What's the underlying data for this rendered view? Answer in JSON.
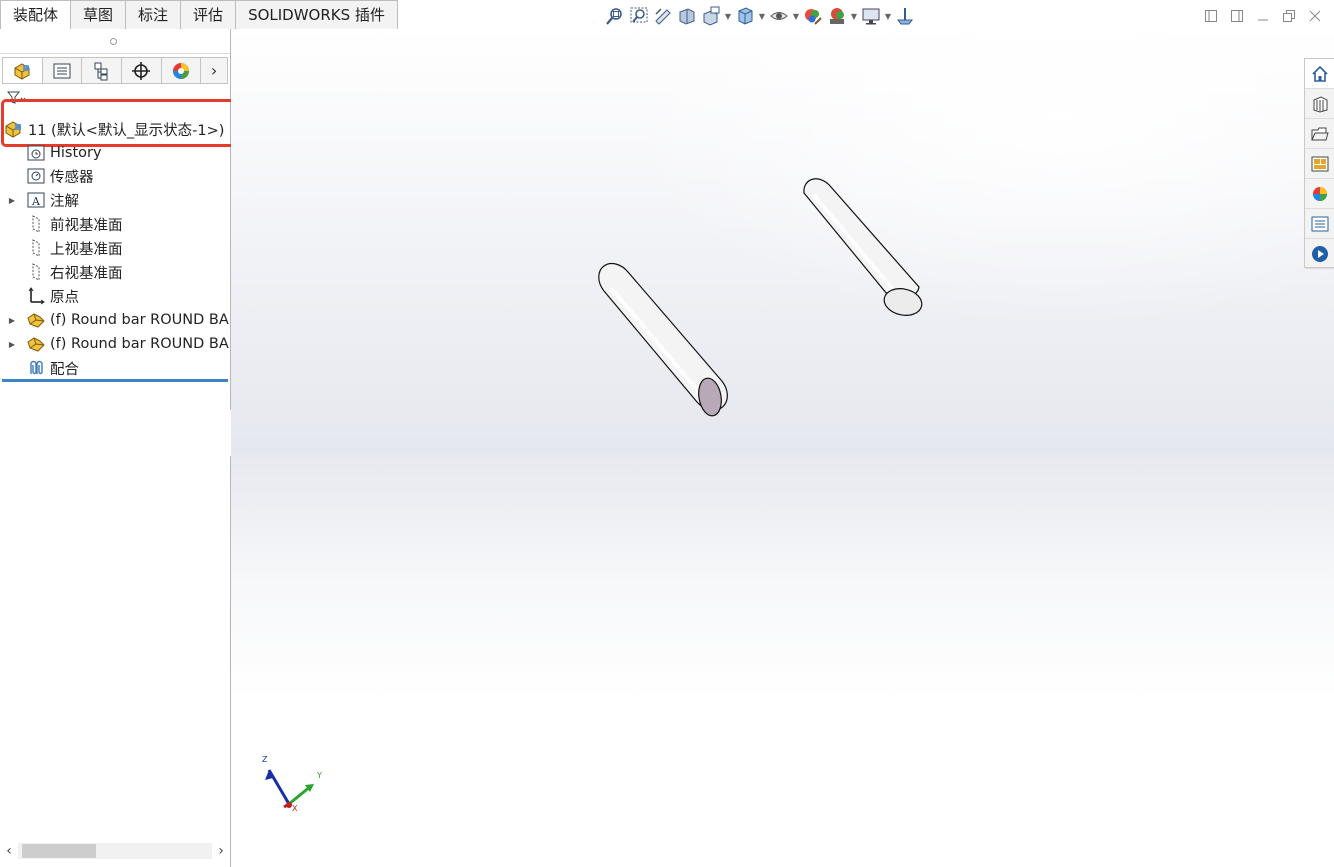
{
  "command_tabs": [
    "装配体",
    "草图",
    "标注",
    "评估",
    "SOLIDWORKS 插件"
  ],
  "view_toolbar_icons": [
    "zoom-to-fit-icon",
    "zoom-to-area-icon",
    "previous-view-icon",
    "section-view-icon",
    "dynamic-annotation-view-icon",
    "view-orientation-icon",
    "display-style-icon",
    "hide-show-items-icon",
    "edit-appearance-icon",
    "apply-scene-icon",
    "view-settings-icon",
    "rotate-view-icon"
  ],
  "window_controls": [
    "tile-left-icon",
    "tile-right-icon",
    "minimize-icon",
    "restore-icon",
    "close-icon"
  ],
  "manager_tabs": [
    "featuremanager-icon",
    "propertymanager-icon",
    "configurationmanager-icon",
    "dimxpertmanager-icon",
    "displaymanager-icon"
  ],
  "tree": {
    "root_label": "11  (默认<默认_显示状态-1>)",
    "items": [
      {
        "label": "History",
        "icon": "history-icon",
        "expandable": false
      },
      {
        "label": "传感器",
        "icon": "sensor-icon",
        "expandable": false
      },
      {
        "label": "注解",
        "icon": "annotations-icon",
        "expandable": true
      },
      {
        "label": "前视基准面",
        "icon": "plane-icon",
        "expandable": false
      },
      {
        "label": "上视基准面",
        "icon": "plane-icon",
        "expandable": false
      },
      {
        "label": "右视基准面",
        "icon": "plane-icon",
        "expandable": false
      },
      {
        "label": "原点",
        "icon": "origin-icon",
        "expandable": false
      },
      {
        "label": "(f) Round bar ROUND BA",
        "icon": "part-icon",
        "expandable": true
      },
      {
        "label": "(f) Round bar ROUND BA",
        "icon": "part-icon",
        "expandable": true
      },
      {
        "label": "配合",
        "icon": "mates-icon",
        "expandable": false
      }
    ]
  },
  "triad": {
    "x": "X",
    "y": "Y",
    "z": "Z"
  },
  "task_pane_icons": [
    "home-icon",
    "design-library-icon",
    "file-explorer-icon",
    "view-palette-icon",
    "appearances-icon",
    "custom-properties-icon",
    "solidworks-resources-icon"
  ],
  "colors": {
    "highlight": "#e43b2c",
    "tree_end_line": "#3a85c7"
  }
}
